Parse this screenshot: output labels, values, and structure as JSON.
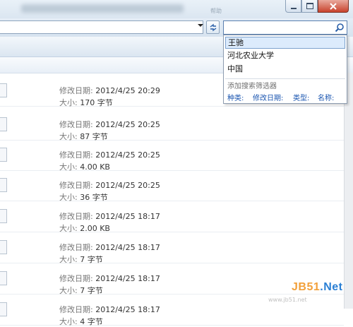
{
  "window": {
    "title": "",
    "title_right": "帮助"
  },
  "addressbar": {
    "value": ""
  },
  "search": {
    "value": "",
    "placeholder": ""
  },
  "suggestions": {
    "items": [
      "王驰",
      "河北农业大学",
      "中国"
    ],
    "filter_title": "添加搜索筛选器",
    "filters": [
      "种类:",
      "修改日期:",
      "类型:",
      "名称:"
    ]
  },
  "files": {
    "date_label": "修改日期:",
    "size_label": "大小:",
    "rows": [
      {
        "date": "2012/4/25 20:29",
        "size": "170 字节"
      },
      {
        "date": "2012/4/25 20:25",
        "size": "87 字节"
      },
      {
        "date": "2012/4/25 20:25",
        "size": "4.00 KB"
      },
      {
        "date": "2012/4/25 20:25",
        "size": "36 字节"
      },
      {
        "date": "2012/4/25 18:17",
        "size": "2.00 KB"
      },
      {
        "date": "2012/4/25 18:17",
        "size": "7 字节"
      },
      {
        "date": "2012/4/25 18:17",
        "size": "7 字节"
      },
      {
        "date": "2012/4/25 18:17",
        "size": "4 字节"
      }
    ]
  },
  "watermark": {
    "part1": "JB51",
    "part2": ".Net",
    "sub": "www.jb51.net"
  }
}
